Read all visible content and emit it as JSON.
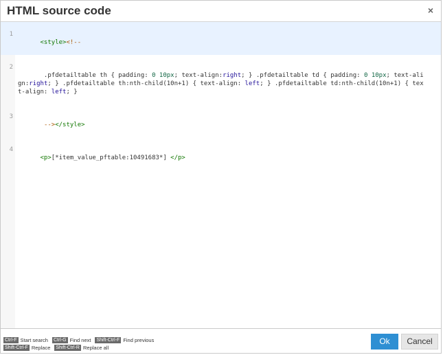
{
  "dialog": {
    "title": "HTML source code",
    "close_glyph": "×"
  },
  "editor": {
    "lines": [
      {
        "number": "1",
        "text": "<style><!--"
      },
      {
        "number": "2",
        "text": " .pfdetailtable th { padding: 0 10px; text-align:right; } .pfdetailtable td { padding: 0 10px; text-align:right; } .pfdetailtable th:nth-child(10n+1) { text-align: left; } .pfdetailtable td:nth-child(10n+1) { text-align: left; }"
      },
      {
        "number": "3",
        "text": " --></style>"
      },
      {
        "number": "4",
        "text": "<p>[*item_value_pftable:10491683*] </p>"
      }
    ]
  },
  "shortcuts": {
    "row1": [
      {
        "key": "Ctrl-F",
        "desc": "Start search"
      },
      {
        "key": "Ctrl-G",
        "desc": "Find next"
      },
      {
        "key": "Shift-Ctrl-F",
        "desc": "Find previous"
      }
    ],
    "row2": [
      {
        "key": "Shift-Ctrl-F",
        "desc": "Replace"
      },
      {
        "key": "Shift-Ctrl-R",
        "desc": "Replace all"
      }
    ]
  },
  "buttons": {
    "ok": "Ok",
    "cancel": "Cancel"
  },
  "colors": {
    "ok_button": "#2e8fd3",
    "tag": "#117700",
    "comment": "#aa5500",
    "keyword": "#221199",
    "number": "#116644",
    "active_line": "#e8f2ff"
  }
}
